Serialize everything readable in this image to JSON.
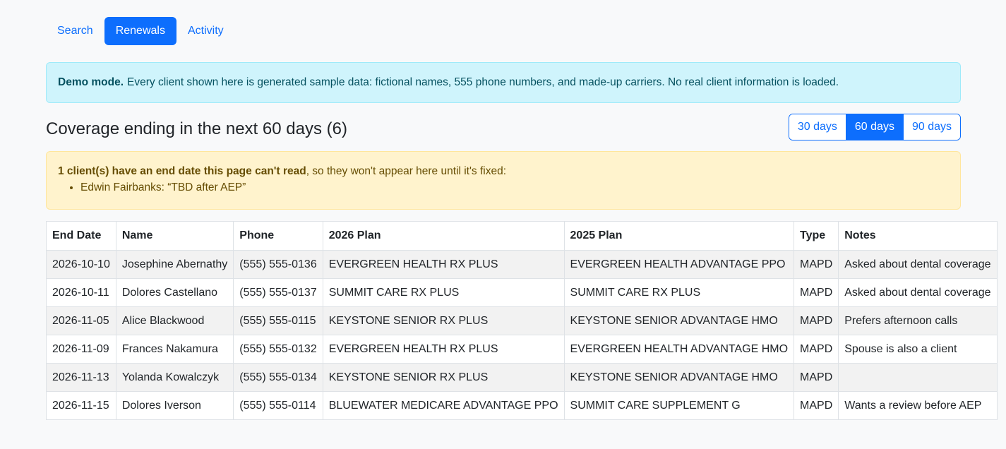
{
  "nav": {
    "items": [
      {
        "label": "Search"
      },
      {
        "label": "Renewals",
        "active": true
      },
      {
        "label": "Activity"
      }
    ]
  },
  "demo_alert": {
    "strong": "Demo mode.",
    "text": "Every client shown here is generated sample data: fictional names, 555 phone numbers, and made-up carriers. No real client information is loaded."
  },
  "heading": "Coverage ending in the next 60 days (6)",
  "range": {
    "options": [
      {
        "label": "30 days"
      },
      {
        "label": "60 days",
        "active": true
      },
      {
        "label": "90 days"
      }
    ]
  },
  "warning": {
    "strong": "1 client(s) have an end date this page can't read",
    "text": ", so they won't appear here until it's fixed:",
    "items": [
      "Edwin Fairbanks: “TBD after AEP”"
    ]
  },
  "table": {
    "headers": [
      "End Date",
      "Name",
      "Phone",
      "2026 Plan",
      "2025 Plan",
      "Type",
      "Notes"
    ],
    "rows": [
      [
        "2026-10-10",
        "Josephine Abernathy",
        "(555) 555-0136",
        "EVERGREEN HEALTH RX PLUS",
        "EVERGREEN HEALTH ADVANTAGE PPO",
        "MAPD",
        "Asked about dental coverage"
      ],
      [
        "2026-10-11",
        "Dolores Castellano",
        "(555) 555-0137",
        "SUMMIT CARE RX PLUS",
        "SUMMIT CARE RX PLUS",
        "MAPD",
        "Asked about dental coverage"
      ],
      [
        "2026-11-05",
        "Alice Blackwood",
        "(555) 555-0115",
        "KEYSTONE SENIOR RX PLUS",
        "KEYSTONE SENIOR ADVANTAGE HMO",
        "MAPD",
        "Prefers afternoon calls"
      ],
      [
        "2026-11-09",
        "Frances Nakamura",
        "(555) 555-0132",
        "EVERGREEN HEALTH RX PLUS",
        "EVERGREEN HEALTH ADVANTAGE HMO",
        "MAPD",
        "Spouse is also a client"
      ],
      [
        "2026-11-13",
        "Yolanda Kowalczyk",
        "(555) 555-0134",
        "KEYSTONE SENIOR RX PLUS",
        "KEYSTONE SENIOR ADVANTAGE HMO",
        "MAPD",
        ""
      ],
      [
        "2026-11-15",
        "Dolores Iverson",
        "(555) 555-0114",
        "BLUEWATER MEDICARE ADVANTAGE PPO",
        "SUMMIT CARE SUPPLEMENT G",
        "MAPD",
        "Wants a review before AEP"
      ]
    ]
  },
  "colors": {
    "primary": "#0d6efd",
    "info_bg": "#cff4fc",
    "warning_bg": "#fff3cd",
    "stripe": "#f2f2f2"
  }
}
